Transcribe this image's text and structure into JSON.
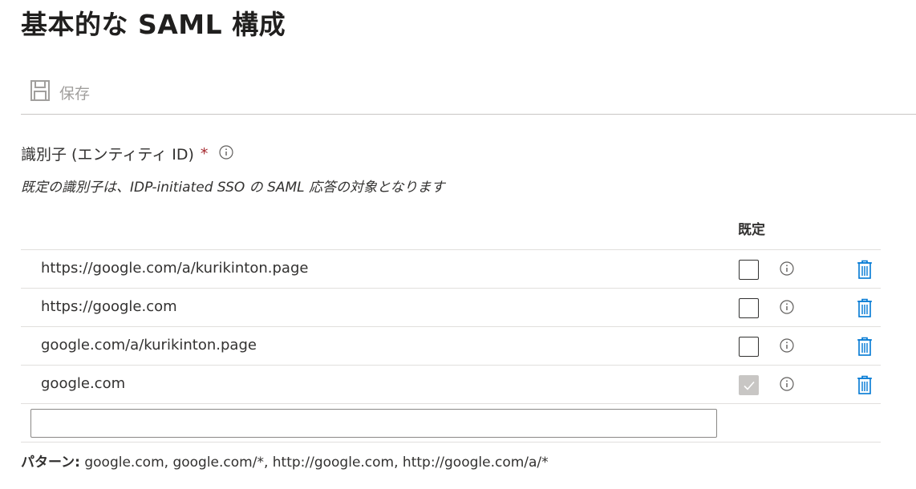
{
  "page": {
    "title": "基本的な SAML 構成"
  },
  "toolbar": {
    "save_label": "保存"
  },
  "identifier": {
    "label": "識別子 (エンティティ ID)",
    "required_mark": "*",
    "description": "既定の識別子は、IDP-initiated SSO の SAML 応答の対象となります",
    "default_column_header": "既定",
    "rows": [
      {
        "value": "https://google.com/a/kurikinton.page",
        "default": false
      },
      {
        "value": "https://google.com",
        "default": false
      },
      {
        "value": "google.com/a/kurikinton.page",
        "default": false
      },
      {
        "value": "google.com",
        "default": true
      }
    ],
    "new_value": "",
    "pattern_label": "パターン:",
    "pattern_text": "google.com, google.com/*, http://google.com, http://google.com/a/*"
  },
  "colors": {
    "accent": "#0078d4",
    "required": "#a4262c",
    "disabled": "#a19f9d"
  },
  "icons": {
    "save": "save-icon",
    "info": "info-icon",
    "delete": "trash-icon",
    "check": "checkmark-icon"
  }
}
